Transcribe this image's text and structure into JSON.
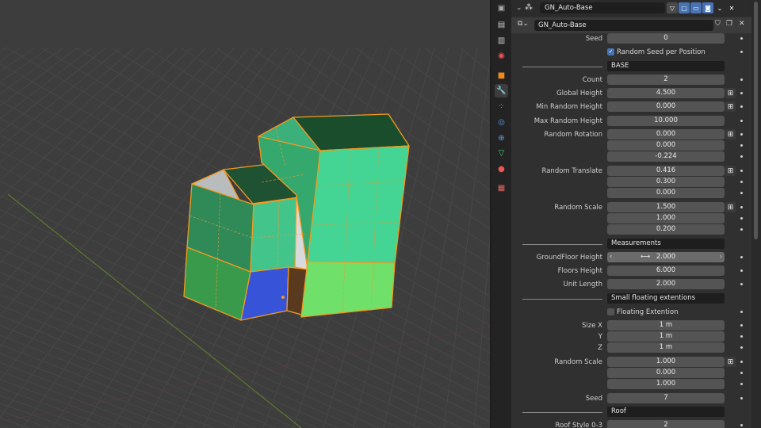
{
  "header": {
    "modifier_name": "GN_Auto-Base",
    "nodegroup_name": "GN_Auto-Base"
  },
  "tabs": [
    "tool-icon",
    "render-icon",
    "output-icon",
    "view-layer-icon",
    "scene-icon",
    "wrench-icon",
    "particles-icon",
    "physics-icon",
    "constraints-icon",
    "data-icon",
    "material-icon",
    "texture-icon"
  ],
  "fields": {
    "seed": {
      "label": "Seed",
      "value": "0"
    },
    "random_seed_per_position": {
      "label": "Random Seed per Position",
      "checked": true
    },
    "base_section": "BASE",
    "count": {
      "label": "Count",
      "value": "2"
    },
    "global_height": {
      "label": "Global Height",
      "value": "4.500"
    },
    "min_random_height": {
      "label": "Min Random Height",
      "value": "0.000"
    },
    "max_random_height": {
      "label": "Max Random Height",
      "value": "10.000"
    },
    "random_rotation": {
      "label": "Random Rotation",
      "x": "0.000",
      "y": "0.000",
      "z": "-0.224"
    },
    "random_translate": {
      "label": "Random Translate",
      "x": "0.416",
      "y": "0.300",
      "z": "0.000"
    },
    "random_scale": {
      "label": "Random Scale",
      "x": "1.500",
      "y": "1.000",
      "z": "0.200"
    },
    "measurements_section": "Measurements",
    "groundfloor_height": {
      "label": "GroundFloor Height",
      "value": "2.000"
    },
    "floors_height": {
      "label": "Floors Height",
      "value": "6.000"
    },
    "unit_length": {
      "label": "Unit Length",
      "value": "2.000"
    },
    "small_section": "Small floating extentions",
    "floating_extention": {
      "label": "Floating Extention",
      "checked": false
    },
    "size": {
      "label_x": "Size X",
      "label_y": "Y",
      "label_z": "Z",
      "x": "1 m",
      "y": "1 m",
      "z": "1 m"
    },
    "random_scale2": {
      "label": "Random Scale",
      "x": "1.000",
      "y": "0.000",
      "z": "1.000"
    },
    "seed2": {
      "label": "Seed",
      "value": "7"
    },
    "roof_section": "Roof",
    "roof_style": {
      "label": "Roof Style 0-3",
      "value": "2"
    }
  }
}
